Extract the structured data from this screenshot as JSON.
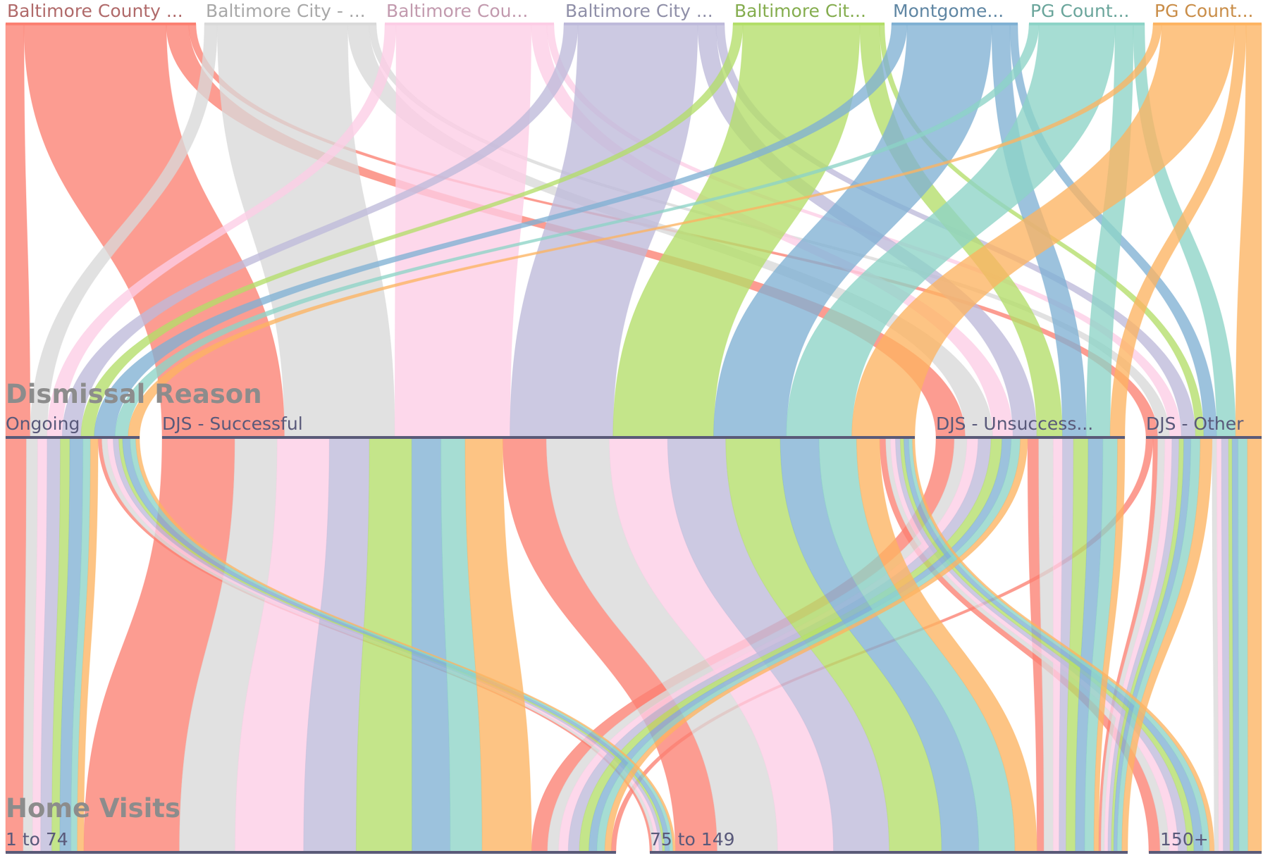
{
  "chart_data": {
    "type": "parallel-sets",
    "dimensions": [
      {
        "title": "",
        "categories": [
          {
            "label": "Baltimore County ...",
            "color": "#fb8072"
          },
          {
            "label": "Baltimore City - ...",
            "color": "#d9d9d9"
          },
          {
            "label": "Baltimore Cou...",
            "color": "#fccde5"
          },
          {
            "label": "Baltimore City ...",
            "color": "#bebada"
          },
          {
            "label": "Baltimore Cit...",
            "color": "#b3de69"
          },
          {
            "label": "Montgome...",
            "color": "#80b1d3"
          },
          {
            "label": "PG Count...",
            "color": "#8dd3c7"
          },
          {
            "label": "PG Count...",
            "color": "#fdb462"
          }
        ]
      },
      {
        "title": "Dismissal Reason",
        "categories": [
          {
            "label": "Ongoing"
          },
          {
            "label": "DJS - Successful"
          },
          {
            "label": "DJS - Unsuccess..."
          },
          {
            "label": "DJS - Other"
          }
        ]
      },
      {
        "title": "Home Visits",
        "categories": [
          {
            "label": "1 to 74"
          },
          {
            "label": "75 to 149"
          },
          {
            "label": "150+"
          }
        ]
      }
    ],
    "label_colors": {
      "title": "#8c8c8c",
      "axis_label": "#59597a",
      "axis_line": "#5a5a78"
    }
  }
}
